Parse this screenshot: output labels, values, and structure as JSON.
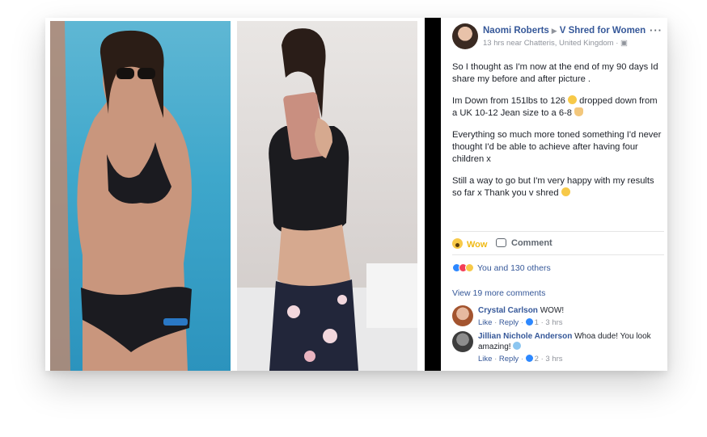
{
  "post": {
    "author": "Naomi Roberts",
    "group": "V Shred for Women",
    "meta": "13 hrs near Chatteris, United Kingdom ·",
    "paragraphs": [
      "So I thought as I'm now at the end of my 90 days Id share my before and after picture .",
      "Im Down from 151lbs to 126",
      "dropped down from a UK 10-12 Jean size to a 6-8",
      "Everything so much more toned something I'd never thought I'd be able to achieve after having four children x",
      "Still a way to go but I'm very happy with my results so far x Thank you v shred"
    ]
  },
  "actions": {
    "wow": "Wow",
    "comment": "Comment"
  },
  "reactions": {
    "summary": "You and 130 others"
  },
  "comments_link": "View 19 more comments",
  "comments": [
    {
      "name": "Crystal Carlson",
      "text": "WOW!",
      "like": "Like",
      "reply": "Reply",
      "count": "1",
      "time": "3 hrs"
    },
    {
      "name": "Jillian Nichole Anderson",
      "text": "Whoa dude! You look amazing!",
      "like": "Like",
      "reply": "Reply",
      "count": "2",
      "time": "3 hrs"
    }
  ]
}
